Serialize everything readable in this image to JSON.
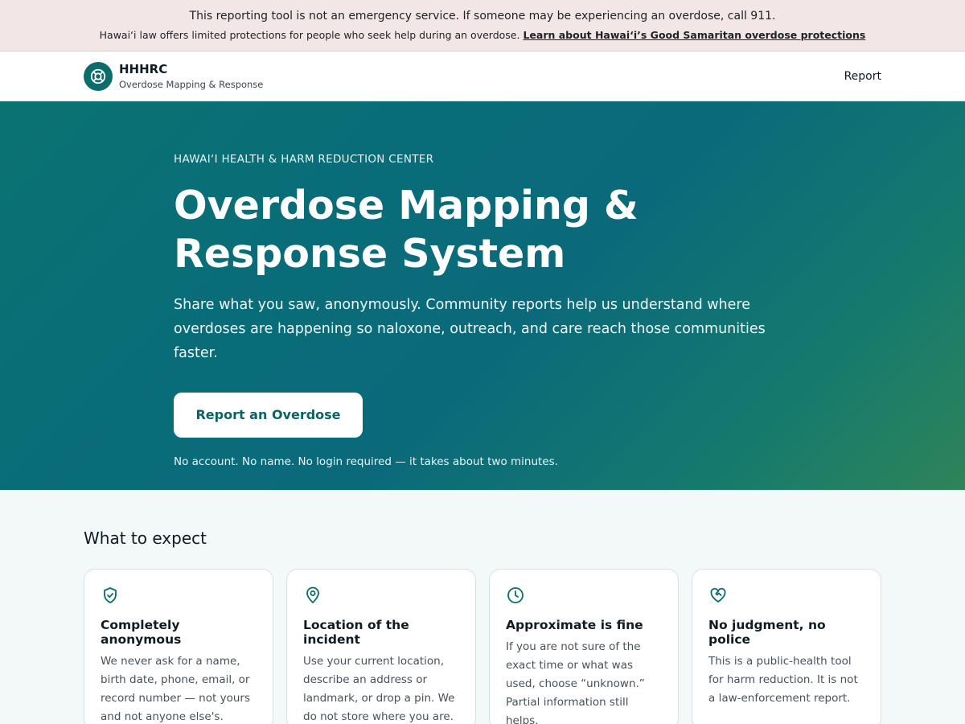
{
  "alert": {
    "line1": "This reporting tool is not an emergency service. If someone may be experiencing an overdose, call 911.",
    "line2": "Hawai‘i law offers limited protections for people who seek help during an overdose.",
    "link": "Learn about Hawai‘i’s Good Samaritan overdose protections"
  },
  "header": {
    "logo_icon": "lifebuoy-icon",
    "name": "HHHRC",
    "subtitle": "Overdose Mapping & Response",
    "nav_report": "Report"
  },
  "hero": {
    "eyebrow": "HAWAI‘I HEALTH & HARM REDUCTION CENTER",
    "title": "Overdose Mapping & Response System",
    "description": "Share what you saw, anonymously. Community reports help us understand where overdoses are happening so naloxone, outreach, and care reach those communities faster.",
    "cta": "Report an Overdose",
    "note": "No account. No name. No login required — it takes about two minutes."
  },
  "expect": {
    "heading": "What to expect",
    "cards": [
      {
        "icon": "shield-check-icon",
        "title": "Completely anonymous",
        "text": "We never ask for a name, birth date, phone, email, or record number — not yours and not anyone else's."
      },
      {
        "icon": "map-pin-icon",
        "title": "Location of the incident",
        "text": "Use your current location, describe an address or landmark, or drop a pin. We do not store where you are."
      },
      {
        "icon": "clock-icon",
        "title": "Approximate is fine",
        "text": "If you are not sure of the exact time or what was used, choose “unknown.” Partial information still helps."
      },
      {
        "icon": "heart-handshake-icon",
        "title": "No judgment, no police",
        "text": "This is a public-health tool for harm reduction. It is not a law-enforcement report."
      }
    ]
  },
  "colors": {
    "accent": "#0b6d6b",
    "alert_bg": "#f3e6e6",
    "hero_start": "#0b7272",
    "hero_end": "#2f8458"
  }
}
